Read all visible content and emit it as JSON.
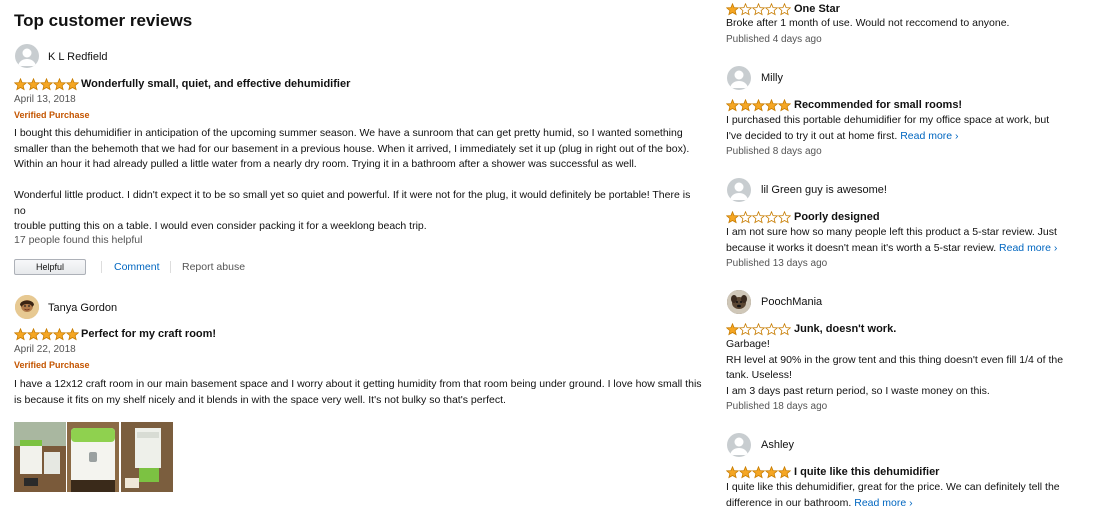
{
  "section_title": "Top customer reviews",
  "left_reviews": [
    {
      "name": "K L Redfield",
      "stars": 5,
      "title": "Wonderfully small, quiet, and effective dehumidifier",
      "date": "April 13, 2018",
      "verified": "Verified Purchase",
      "body_lines": [
        "I bought this dehumidifier in anticipation of the upcoming summer season. We have a sunroom that can get pretty humid, so I wanted something",
        "smaller than the behemoth that we had for our basement in a previous house. When it arrived, I immediately set it up (plug in right out of the box).",
        "Within an hour it had already pulled a little water from a nearly dry room. Trying it in a bathroom after a shower was successful as well.",
        "Wonderful little product. I didn't expect it to be so small yet so quiet and powerful. If it were not for the plug, it would definitely be portable! There is no",
        "trouble putting this on a table. I would even consider packing it for a weeklong beach trip."
      ],
      "helpful_count": "17 people found this helpful",
      "helpful_button": "Helpful",
      "comment_link": "Comment",
      "report_link": "Report abuse"
    },
    {
      "name": "Tanya Gordon",
      "stars": 5,
      "title": "Perfect for my craft room!",
      "date": "April 22, 2018",
      "verified": "Verified Purchase",
      "body_lines": [
        "I have a 12x12 craft room in our main basement space and I worry about it getting humidity from that room being under ground. I love how small this",
        "is because it fits on my shelf nicely and it blends in with the space very well. It's not bulky so that's perfect."
      ]
    }
  ],
  "right_reviews": [
    {
      "stars": 1,
      "title": "One Star",
      "body_lines": [
        "Broke after 1 month of use. Would not reccomend to anyone."
      ],
      "published": "Published 4 days ago"
    },
    {
      "name": "Milly",
      "stars": 5,
      "title": "Recommended for small rooms!",
      "body_lines": [
        "I purchased this portable dehumidifier for my office space at work, but",
        "I've decided to try it out at home first."
      ],
      "read_more": "Read more ›",
      "published": "Published 8 days ago"
    },
    {
      "name": "lil Green guy is awesome!",
      "stars": 1,
      "title": "Poorly designed",
      "body_lines": [
        "I am not sure how so many people left this product a 5-star review. Just",
        "because it works it doesn't mean it's worth a 5-star review."
      ],
      "read_more": "Read more ›",
      "published": "Published 13 days ago"
    },
    {
      "name": "PoochMania",
      "stars": 1,
      "title": "Junk, doesn't work.",
      "body_lines": [
        "Garbage!",
        "RH level at 90% in the grow tent and this thing doesn't even fill 1/4 of the",
        "tank. Useless!",
        "I am 3 days past return period, so I waste money on this."
      ],
      "published": "Published 18 days ago"
    },
    {
      "name": "Ashley",
      "stars": 5,
      "title": "I quite like this dehumidifier",
      "body_lines": [
        "I quite like this dehumidifier, great for the price. We can definitely tell the",
        "difference in our bathroom."
      ],
      "read_more": "Read more ›"
    }
  ],
  "colors": {
    "star": "#f5a623",
    "star_outline": "#c77c00",
    "link": "#0066c0",
    "verified": "#c45500"
  },
  "icons": {
    "star": "star-icon",
    "avatar": "avatar-icon"
  }
}
